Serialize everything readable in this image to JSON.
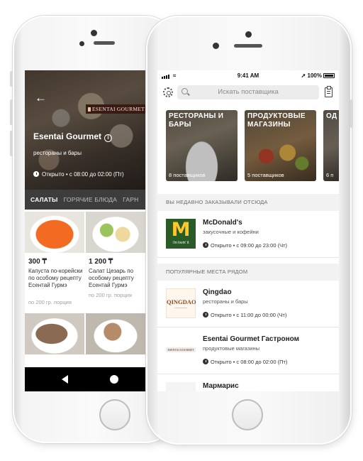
{
  "restaurant_screen": {
    "brand_tag": "ESENTAI GOURMET",
    "title": "Esentai Gourmet",
    "subtitle": "рестораны и бары",
    "hours": "Открыто • с 08:00 до 02:00 (Пт)",
    "tabs": [
      "САЛАТЫ",
      "ГОРЯЧИЕ БЛЮДА",
      "ГАРН"
    ],
    "items": [
      {
        "price": "300 ₸",
        "name": "Капуста по-корейски по особому рецепту Есентай Гурмэ",
        "portion": "по 200 гр. порция"
      },
      {
        "price": "1 200 ₸",
        "name": "Салат Цезарь по особому рецепту Есентай Гурмэ",
        "portion": "по 200 гр. порция"
      }
    ]
  },
  "status_bar": {
    "time": "9:41 AM",
    "battery": "100%"
  },
  "search": {
    "placeholder": "Искать поставщика"
  },
  "categories": [
    {
      "title": "РЕСТОРАНЫ И БАРЫ",
      "count": "8 поставщиков"
    },
    {
      "title": "ПРОДУКТОВЫЕ МАГАЗИНЫ",
      "count": "5 поставщиков"
    },
    {
      "title": "ОД",
      "count": "6 п"
    }
  ],
  "recent": {
    "header": "ВЫ НЕДАВНО ЗАКАЗЫВАЛИ ОТСЮДА",
    "items": [
      {
        "name": "McDonald's",
        "category": "закусочные и кофейни",
        "hours": "Открыто • с 09:00 до 23:00 (Чт)",
        "logo_text": "i'm lovin' it"
      }
    ]
  },
  "popular": {
    "header": "ПОПУЛЯРНЫЕ МЕСТА РЯДОМ",
    "items": [
      {
        "name": "Qingdao",
        "category": "рестораны и бары",
        "hours": "Открыто • с 11:00 до 00:00 (Чт)",
        "logo_text": "QINGDAO"
      },
      {
        "name": "Esentai Gourmet Гастроном",
        "category": "продуктовые магазины",
        "hours": "Открыто • с 08:00 до 02:00 (Пт)",
        "logo_text": "ESENTAI GOURMET"
      },
      {
        "name": "Мармарис",
        "category": "",
        "hours": ""
      }
    ]
  },
  "colors": {
    "tabs_bg": "#3d3d3d",
    "section_bg": "#f2f2f2",
    "mcd_green": "#2a5a26",
    "mcd_yellow": "#ffc72c"
  }
}
